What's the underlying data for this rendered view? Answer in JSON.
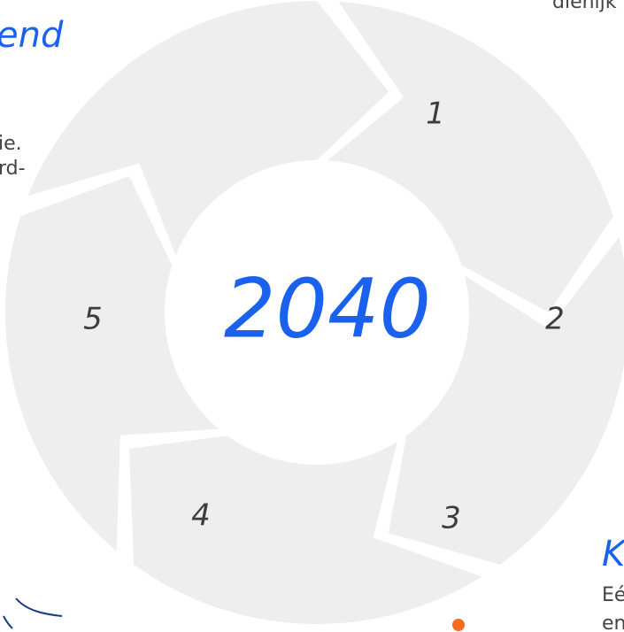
{
  "hub": {
    "year": "2040"
  },
  "segments": [
    {
      "label": "1"
    },
    {
      "label": "2"
    },
    {
      "label": "3"
    },
    {
      "label": "4"
    },
    {
      "label": "5"
    }
  ],
  "fragments": {
    "top_left_heading": "end",
    "top_left_line1": "ie.",
    "top_left_line2": "rd-",
    "top_right_text": "dienijk",
    "bottom_right_heading": "K",
    "bottom_right_line1": "Eé",
    "bottom_right_line2": "en"
  },
  "colors": {
    "accent": "#1a62ee",
    "segment_fill": "#eeeeee",
    "dot": "#f36c21"
  }
}
